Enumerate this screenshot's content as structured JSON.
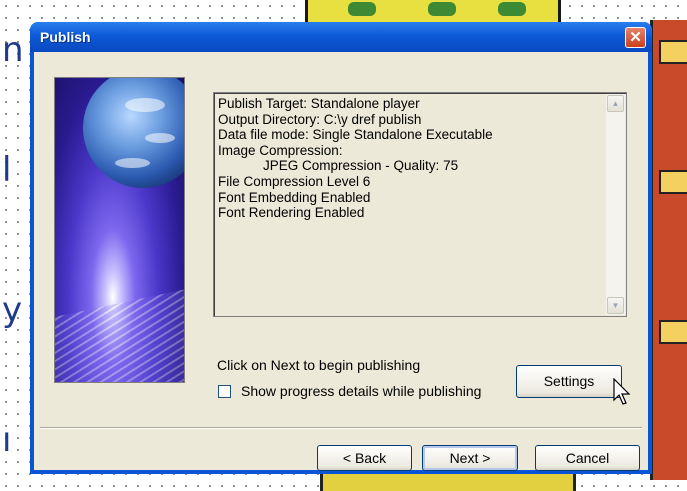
{
  "window": {
    "title": "Publish"
  },
  "title_bar": {
    "close_glyph": "✕"
  },
  "summary": {
    "lines": [
      "Publish Target: Standalone player",
      "Output Directory: C:\\y dref publish",
      "Data file mode: Single Standalone Executable",
      "Image Compression:",
      "            JPEG Compression - Quality: 75",
      "File Compression Level 6",
      "Font Embedding Enabled",
      "Font Rendering Enabled"
    ]
  },
  "instruction": "Click on Next to begin publishing",
  "progress_checkbox": {
    "label": "Show progress details while publishing",
    "checked": false
  },
  "buttons": {
    "settings": "Settings",
    "back": "< Back",
    "next": "Next >",
    "cancel": "Cancel"
  },
  "icons": {
    "close": "close-icon",
    "scroll_up": "scroll-up-arrow-icon",
    "scroll_down": "scroll-down-arrow-icon",
    "cursor": "mouse-pointer-icon"
  },
  "colors": {
    "title_bar": "#0a55d6",
    "dialog_face": "#ece9d8",
    "close_button": "#c8401e"
  }
}
